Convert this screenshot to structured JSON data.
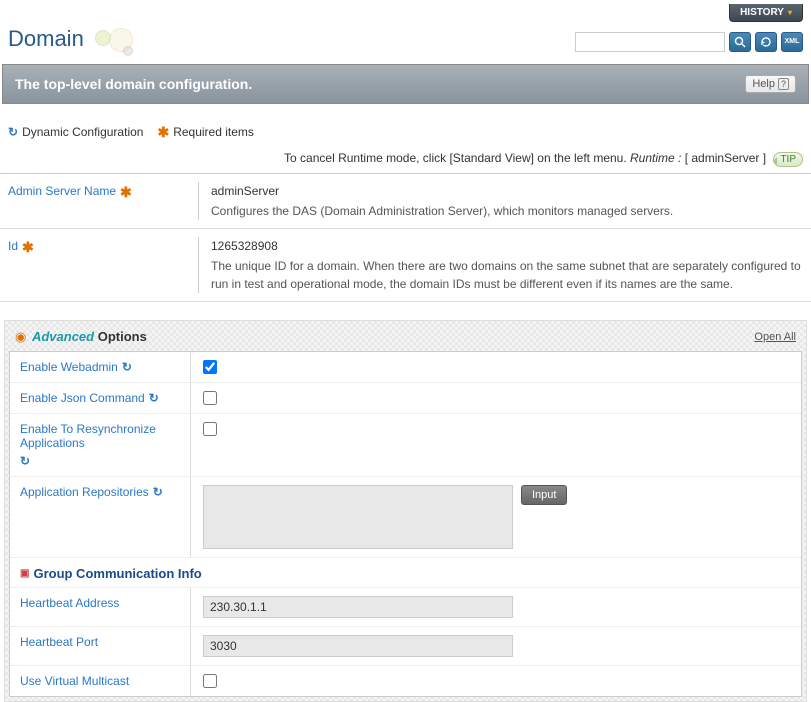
{
  "topbar": {
    "history": "HISTORY"
  },
  "page": {
    "title": "Domain"
  },
  "banner": {
    "text": "The top-level domain configuration.",
    "help": "Help"
  },
  "legend": {
    "dynamic": "Dynamic Configuration",
    "required": "Required items"
  },
  "runtime": {
    "msg_prefix": "To cancel Runtime mode, click [Standard View] on the left menu. ",
    "runtime_label": "Runtime :",
    "server": "[ adminServer ]",
    "tip": "TIP"
  },
  "fields": {
    "admin_server": {
      "label": "Admin Server Name",
      "value": "adminServer",
      "desc": "Configures the DAS (Domain Administration Server), which monitors managed servers."
    },
    "id": {
      "label": "Id",
      "value": "1265328908",
      "desc": "The unique ID for a domain. When there are two domains on the same subnet that are separately configured to run in test and operational mode, the domain IDs must be different even if its names are the same."
    }
  },
  "advanced": {
    "title_adv": "Advanced",
    "title_opt": "Options",
    "open_all": "Open All",
    "enable_webadmin": "Enable Webadmin",
    "enable_json": "Enable Json Command",
    "enable_resync": "Enable To Resynchronize Applications",
    "app_repos": "Application Repositories",
    "input_btn": "Input",
    "group_comm": "Group Communication Info",
    "heartbeat_addr_label": "Heartbeat Address",
    "heartbeat_addr_value": "230.30.1.1",
    "heartbeat_port_label": "Heartbeat Port",
    "heartbeat_port_value": "3030",
    "use_virtual": "Use Virtual Multicast"
  }
}
